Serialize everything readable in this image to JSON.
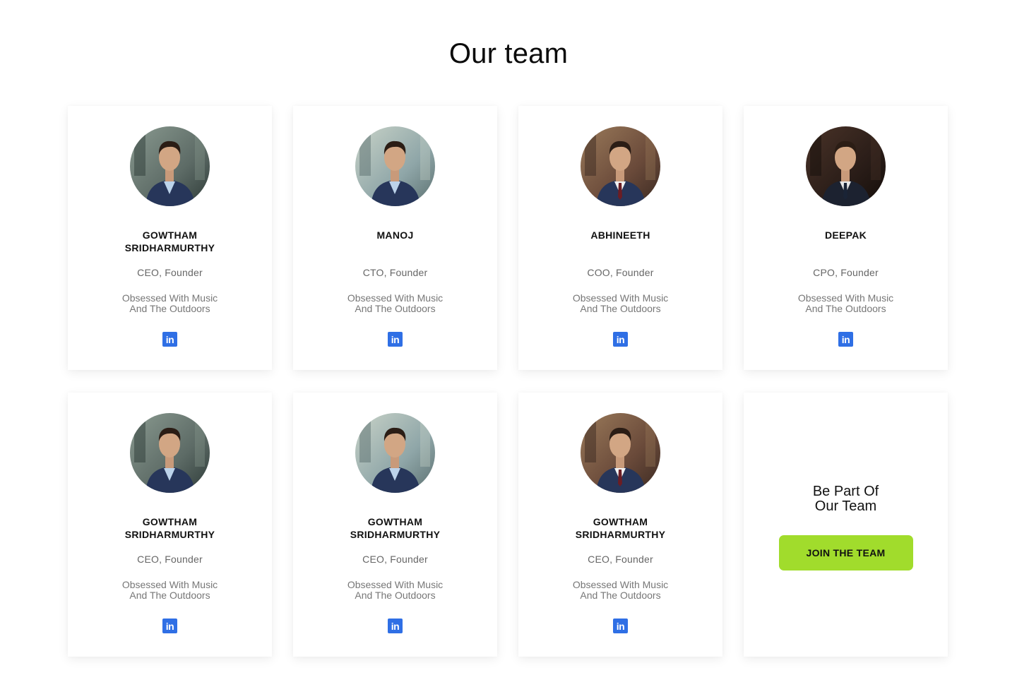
{
  "page": {
    "title": "Our team"
  },
  "members": [
    {
      "name_line1": "GOWTHAM",
      "name_line2": "SRIDHARMURTHY",
      "role": "CEO, Founder",
      "bio_line1": "Obsessed With Music",
      "bio_line2": "And The Outdoors",
      "avatar": "a"
    },
    {
      "name_line1": "MANOJ",
      "name_line2": "",
      "role": "CTO, Founder",
      "bio_line1": "Obsessed With Music",
      "bio_line2": "And The Outdoors",
      "avatar": "b"
    },
    {
      "name_line1": "ABHINEETH",
      "name_line2": "",
      "role": "COO, Founder",
      "bio_line1": "Obsessed With Music",
      "bio_line2": "And The Outdoors",
      "avatar": "c"
    },
    {
      "name_line1": "DEEPAK",
      "name_line2": "",
      "role": "CPO, Founder",
      "bio_line1": "Obsessed With Music",
      "bio_line2": "And The Outdoors",
      "avatar": "d"
    },
    {
      "name_line1": "GOWTHAM",
      "name_line2": "SRIDHARMURTHY",
      "role": "CEO, Founder",
      "bio_line1": "Obsessed With Music",
      "bio_line2": "And The Outdoors",
      "avatar": "a"
    },
    {
      "name_line1": "GOWTHAM",
      "name_line2": "SRIDHARMURTHY",
      "role": "CEO, Founder",
      "bio_line1": "Obsessed With Music",
      "bio_line2": "And The Outdoors",
      "avatar": "b"
    },
    {
      "name_line1": "GOWTHAM",
      "name_line2": "SRIDHARMURTHY",
      "role": "CEO, Founder",
      "bio_line1": "Obsessed With Music",
      "bio_line2": "And The Outdoors",
      "avatar": "c"
    }
  ],
  "social": {
    "icon": "linkedin-icon",
    "glyph": "in",
    "color": "#2f6fe5"
  },
  "join": {
    "heading_line1": "Be Part Of",
    "heading_line2": "Our Team",
    "button_label": "JOIN THE TEAM",
    "button_color": "#a1dc2c"
  }
}
